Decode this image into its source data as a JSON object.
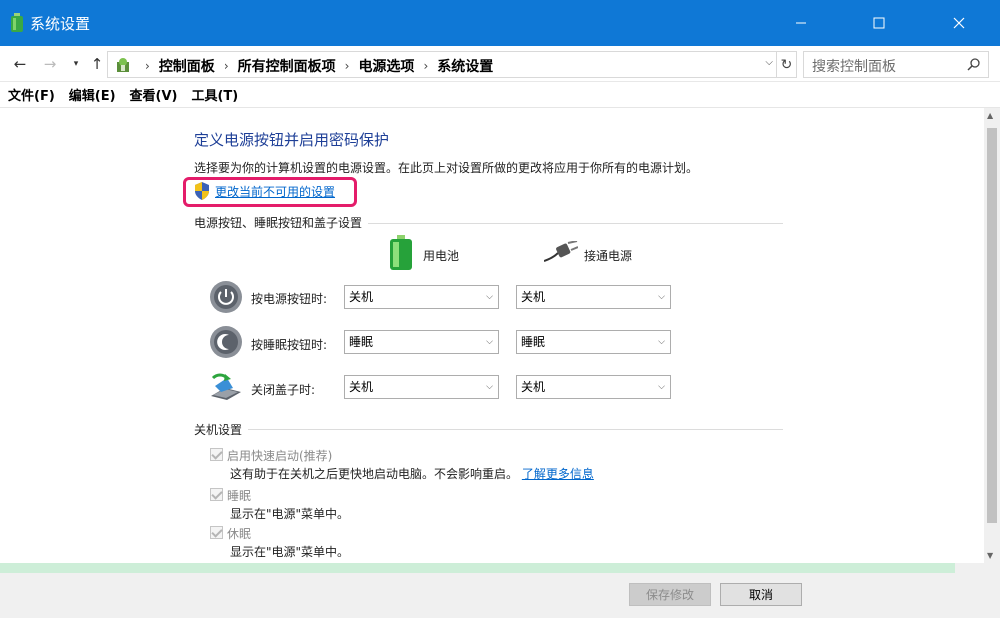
{
  "window": {
    "title": "系统设置"
  },
  "address": {
    "breadcrumbs": [
      "控制面板",
      "所有控制面板项",
      "电源选项",
      "系统设置"
    ],
    "search_placeholder": "搜索控制面板"
  },
  "menu": [
    "文件(F)",
    "编辑(E)",
    "查看(V)",
    "工具(T)"
  ],
  "page": {
    "heading": "定义电源按钮并启用密码保护",
    "description": "选择要为你的计算机设置的电源设置。在此页上对设置所做的更改将应用于你所有的电源计划。",
    "change_link": "更改当前不可用的设置",
    "highlight_color": "#e41c6a"
  },
  "power_buttons": {
    "group_label": "电源按钮、睡眠按钮和盖子设置",
    "col_battery": "用电池",
    "col_plugged": "接通电源",
    "rows": [
      {
        "label": "按电源按钮时:",
        "icon": "power-button-icon",
        "battery": "关机",
        "plugged": "关机"
      },
      {
        "label": "按睡眠按钮时:",
        "icon": "sleep-button-icon",
        "battery": "睡眠",
        "plugged": "睡眠"
      },
      {
        "label": "关闭盖子时:",
        "icon": "laptop-lid-icon",
        "battery": "关机",
        "plugged": "关机"
      }
    ]
  },
  "shutdown": {
    "group_label": "关机设置",
    "fast_startup": {
      "label": "启用快速启动(推荐)",
      "desc": "这有助于在关机之后更快地启动电脑。不会影响重启。",
      "link": "了解更多信息",
      "checked": true
    },
    "sleep": {
      "label": "睡眠",
      "desc": "显示在\"电源\"菜单中。",
      "checked": true
    },
    "hibernate": {
      "label": "休眠",
      "desc": "显示在\"电源\"菜单中。",
      "checked": true
    }
  },
  "footer": {
    "save": "保存修改",
    "cancel": "取消"
  },
  "colors": {
    "titlebar": "#0f78d6",
    "link": "#0066cc",
    "heading": "#1e3f97"
  }
}
